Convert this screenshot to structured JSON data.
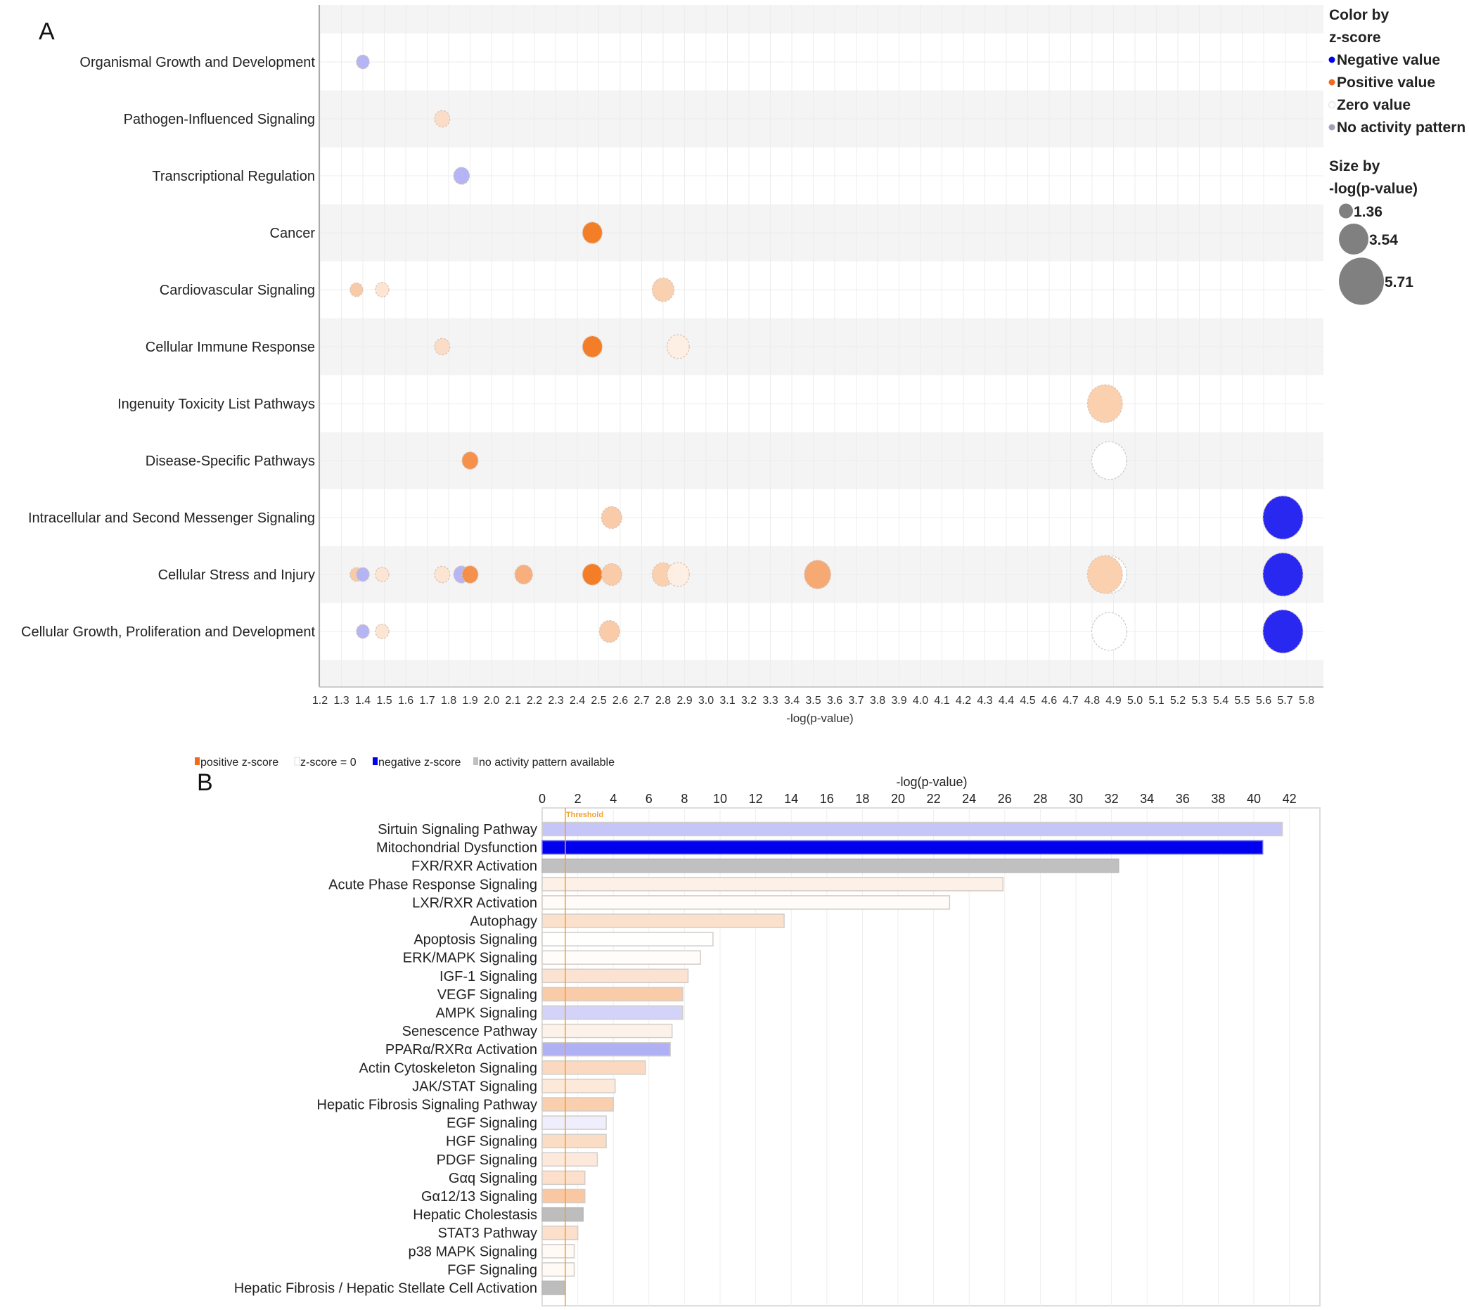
{
  "chart_data": [
    {
      "type": "scatter",
      "panel_label": "A",
      "title": "",
      "xlabel": "-log(p-value)",
      "ylabel": "",
      "xlim": [
        1.2,
        5.8
      ],
      "x_ticks": [
        "1.2",
        "1.3",
        "1.4",
        "1.5",
        "1.6",
        "1.7",
        "1.8",
        "1.9",
        "2.0",
        "2.1",
        "2.2",
        "2.3",
        "2.4",
        "2.5",
        "2.6",
        "2.7",
        "2.8",
        "2.9",
        "3.0",
        "3.1",
        "3.2",
        "3.3",
        "3.4",
        "3.5",
        "3.6",
        "3.7",
        "3.8",
        "3.9",
        "4.0",
        "4.1",
        "4.2",
        "4.3",
        "4.4",
        "4.5",
        "4.6",
        "4.7",
        "4.8",
        "4.9",
        "5.0",
        "5.1",
        "5.2",
        "5.3",
        "5.4",
        "5.5",
        "5.6",
        "5.7",
        "5.8"
      ],
      "grid": true,
      "categories": [
        "Organismal Growth and Development",
        "Pathogen-Influenced Signaling",
        "Transcriptional Regulation",
        "Cancer",
        "Cardiovascular Signaling",
        "Cellular Immune Response",
        "Ingenuity Toxicity List Pathways",
        "Disease-Specific Pathways",
        "Intracellular and Second Messenger Signaling",
        "Cellular Stress and Injury",
        "Cellular Growth, Proliferation and Development"
      ],
      "points": [
        {
          "category": 0,
          "x": 1.4,
          "color": "#b3b3f5"
        },
        {
          "category": 1,
          "x": 1.77,
          "color": "#fbdcc5"
        },
        {
          "category": 2,
          "x": 1.86,
          "color": "#b3b3f5"
        },
        {
          "category": 3,
          "x": 2.47,
          "color": "#f47a20"
        },
        {
          "category": 4,
          "x": 1.37,
          "color": "#f8c8a4"
        },
        {
          "category": 4,
          "x": 1.49,
          "color": "#fce4d2"
        },
        {
          "category": 4,
          "x": 2.8,
          "color": "#f9cfae"
        },
        {
          "category": 5,
          "x": 1.77,
          "color": "#fbdcc5"
        },
        {
          "category": 5,
          "x": 2.47,
          "color": "#f47a20"
        },
        {
          "category": 5,
          "x": 2.87,
          "color": "#fdeee2"
        },
        {
          "category": 6,
          "x": 4.86,
          "color": "#fbceab"
        },
        {
          "category": 7,
          "x": 1.9,
          "color": "#f58d45"
        },
        {
          "category": 7,
          "x": 4.88,
          "color": "#ffffff"
        },
        {
          "category": 8,
          "x": 2.56,
          "color": "#f9c9a6"
        },
        {
          "category": 8,
          "x": 5.69,
          "color": "#2121f0"
        },
        {
          "category": 9,
          "x": 1.37,
          "color": "#f8c8a4"
        },
        {
          "category": 9,
          "x": 1.4,
          "color": "#b3b3f5"
        },
        {
          "category": 9,
          "x": 1.49,
          "color": "#fce4d2"
        },
        {
          "category": 9,
          "x": 1.77,
          "color": "#fce4d2"
        },
        {
          "category": 9,
          "x": 1.86,
          "color": "#b3b3f5"
        },
        {
          "category": 9,
          "x": 1.9,
          "color": "#f58d45"
        },
        {
          "category": 9,
          "x": 2.15,
          "color": "#f7ad79"
        },
        {
          "category": 9,
          "x": 2.47,
          "color": "#f47a20"
        },
        {
          "category": 9,
          "x": 2.56,
          "color": "#f9c9a6"
        },
        {
          "category": 9,
          "x": 2.8,
          "color": "#f9cfae"
        },
        {
          "category": 9,
          "x": 2.87,
          "color": "#fdeee2"
        },
        {
          "category": 9,
          "x": 3.52,
          "color": "#f7a66e"
        },
        {
          "category": 9,
          "x": 4.88,
          "color": "#ffffff"
        },
        {
          "category": 9,
          "x": 4.86,
          "color": "#fbceab"
        },
        {
          "category": 9,
          "x": 5.69,
          "color": "#2121f0"
        },
        {
          "category": 10,
          "x": 1.4,
          "color": "#b3b3f5"
        },
        {
          "category": 10,
          "x": 1.49,
          "color": "#fce4d2"
        },
        {
          "category": 10,
          "x": 2.55,
          "color": "#f9c9a6"
        },
        {
          "category": 10,
          "x": 4.88,
          "color": "#ffffff"
        },
        {
          "category": 10,
          "x": 5.69,
          "color": "#2121f0"
        }
      ],
      "legend": {
        "placement": "right",
        "color_title_1": "Color by",
        "color_title_2": "z-score",
        "color_items": [
          {
            "label": "Negative value",
            "color": "#0000ee"
          },
          {
            "label": "Positive value",
            "color": "#f26b1d"
          },
          {
            "label": "Zero value",
            "color": "#ffffff"
          },
          {
            "label": "No activity pattern",
            "color": "#a0a3b8"
          }
        ],
        "size_title_1": "Size by",
        "size_title_2": "-log(p-value)",
        "size_items": [
          {
            "label": "1.36",
            "value": 1.36
          },
          {
            "label": "3.54",
            "value": 3.54
          },
          {
            "label": "5.71",
            "value": 5.71
          }
        ],
        "size_color": "#808080"
      }
    },
    {
      "type": "bar",
      "orientation": "horizontal",
      "panel_label": "B",
      "title": "",
      "xlabel": "-log(p-value)",
      "xlim": [
        0,
        43.7
      ],
      "x_ticks": [
        "0",
        "2",
        "4",
        "6",
        "8",
        "10",
        "12",
        "14",
        "16",
        "18",
        "20",
        "22",
        "24",
        "26",
        "28",
        "30",
        "32",
        "34",
        "36",
        "38",
        "40",
        "42"
      ],
      "grid": true,
      "threshold": {
        "label": "Threshold",
        "value": 1.3,
        "color": "#f0a030"
      },
      "legend": {
        "placement": "top-left",
        "items": [
          {
            "label": "positive z-score",
            "color": "#f26b1d"
          },
          {
            "label": "z-score = 0",
            "color": "#ffffff"
          },
          {
            "label": "negative z-score",
            "color": "#0000ee"
          },
          {
            "label": "no activity pattern available",
            "color": "#c0c0c0"
          }
        ]
      },
      "categories": [
        "Sirtuin Signaling Pathway",
        "Mitochondrial Dysfunction",
        "FXR/RXR Activation",
        "Acute Phase Response Signaling",
        "LXR/RXR Activation",
        "Autophagy",
        "Apoptosis Signaling",
        "ERK/MAPK Signaling",
        "IGF-1 Signaling",
        "VEGF Signaling",
        "AMPK Signaling",
        "Senescence Pathway",
        "PPARα/RXRα Activation",
        "Actin Cytoskeleton Signaling",
        "JAK/STAT Signaling",
        "Hepatic Fibrosis Signaling Pathway",
        "EGF Signaling",
        "HGF Signaling",
        "PDGF Signaling",
        "Gαq Signaling",
        "Gα12/13 Signaling",
        "Hepatic Cholestasis",
        "STAT3 Pathway",
        "p38 MAPK Signaling",
        "FGF Signaling",
        "Hepatic Fibrosis / Hepatic Stellate Cell Activation"
      ],
      "values": [
        41.6,
        40.5,
        32.4,
        25.9,
        22.9,
        13.6,
        9.6,
        8.9,
        8.2,
        7.9,
        7.9,
        7.3,
        7.2,
        5.8,
        4.1,
        4.0,
        3.6,
        3.6,
        3.1,
        2.4,
        2.4,
        2.3,
        2.0,
        1.8,
        1.8,
        1.3
      ],
      "colors": [
        "#c5c5f7",
        "#0000ee",
        "#c0c0c0",
        "#fdf0e6",
        "#fffbf8",
        "#fbe1cc",
        "#ffffff",
        "#fffcfa",
        "#fce3d1",
        "#facba8",
        "#d3d3f9",
        "#fdf2ea",
        "#b0b0f5",
        "#fbd9c0",
        "#fde9da",
        "#f9cfae",
        "#eeeefd",
        "#fbdcc4",
        "#fde9dc",
        "#fce0cb",
        "#f9c8a2",
        "#bdbdbd",
        "#fce0cb",
        "#fffaf6",
        "#fffaf6",
        "#bdbdbd"
      ]
    }
  ]
}
